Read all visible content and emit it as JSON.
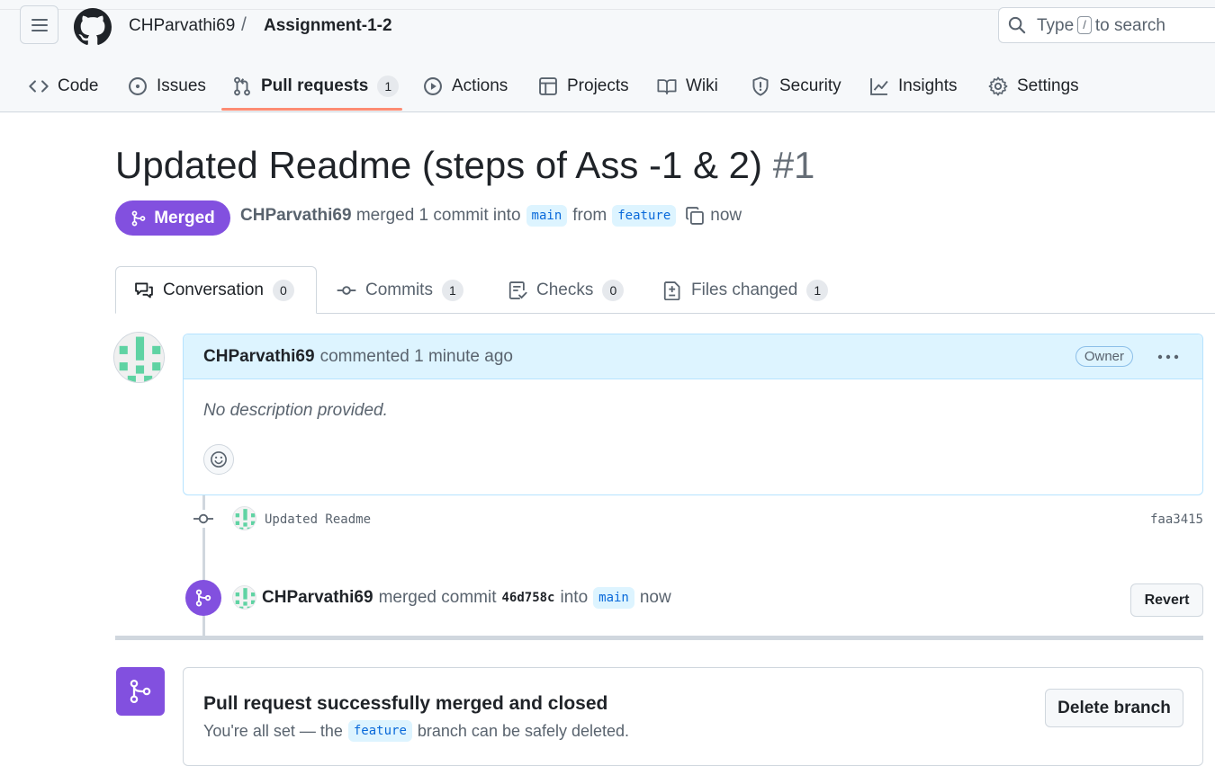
{
  "header": {
    "owner": "CHParvathi69",
    "separator": "/",
    "repo": "Assignment-1-2",
    "search": {
      "prefix": "Type",
      "key": "/",
      "suffix": "to search"
    }
  },
  "nav": {
    "items": [
      {
        "label": "Code",
        "icon": "code-icon"
      },
      {
        "label": "Issues",
        "icon": "issue-opened-icon"
      },
      {
        "label": "Pull requests",
        "icon": "git-pull-request-icon",
        "count": "1"
      },
      {
        "label": "Actions",
        "icon": "play-icon"
      },
      {
        "label": "Projects",
        "icon": "table-icon"
      },
      {
        "label": "Wiki",
        "icon": "book-icon"
      },
      {
        "label": "Security",
        "icon": "shield-icon"
      },
      {
        "label": "Insights",
        "icon": "graph-icon"
      },
      {
        "label": "Settings",
        "icon": "gear-icon"
      }
    ],
    "active_index": 2
  },
  "pr": {
    "title": "Updated Readme (steps of Ass -1 & 2)",
    "number": "#1",
    "state": "Merged",
    "author": "CHParvathi69",
    "meta_merged": "merged 1 commit into",
    "base_branch": "main",
    "meta_from": "from",
    "head_branch": "feature",
    "meta_time": "now"
  },
  "tabs": [
    {
      "label": "Conversation",
      "count": "0",
      "icon": "comment-discussion-icon"
    },
    {
      "label": "Commits",
      "count": "1",
      "icon": "git-commit-icon"
    },
    {
      "label": "Checks",
      "count": "0",
      "icon": "checklist-icon"
    },
    {
      "label": "Files changed",
      "count": "1",
      "icon": "file-diff-icon"
    }
  ],
  "comment": {
    "author": "CHParvathi69",
    "action": "commented 1 minute ago",
    "badge": "Owner",
    "body": "No description provided."
  },
  "commit": {
    "message": "Updated Readme",
    "sha": "faa3415"
  },
  "merge_event": {
    "author": "CHParvathi69",
    "text_merged": "merged commit",
    "sha": "46d758c",
    "text_into": "into",
    "branch": "main",
    "time": "now",
    "revert_label": "Revert"
  },
  "merge_box": {
    "title": "Pull request successfully merged and closed",
    "sub_prefix": "You're all set — the",
    "branch": "feature",
    "sub_suffix": "branch can be safely deleted.",
    "delete_label": "Delete branch"
  },
  "colors": {
    "merged_purple": "#8250df",
    "accent_blue": "#0969da",
    "nav_underline": "#fd8c73",
    "comment_header_bg": "#ddf4ff",
    "identicon_green": "#5fd3a3"
  }
}
